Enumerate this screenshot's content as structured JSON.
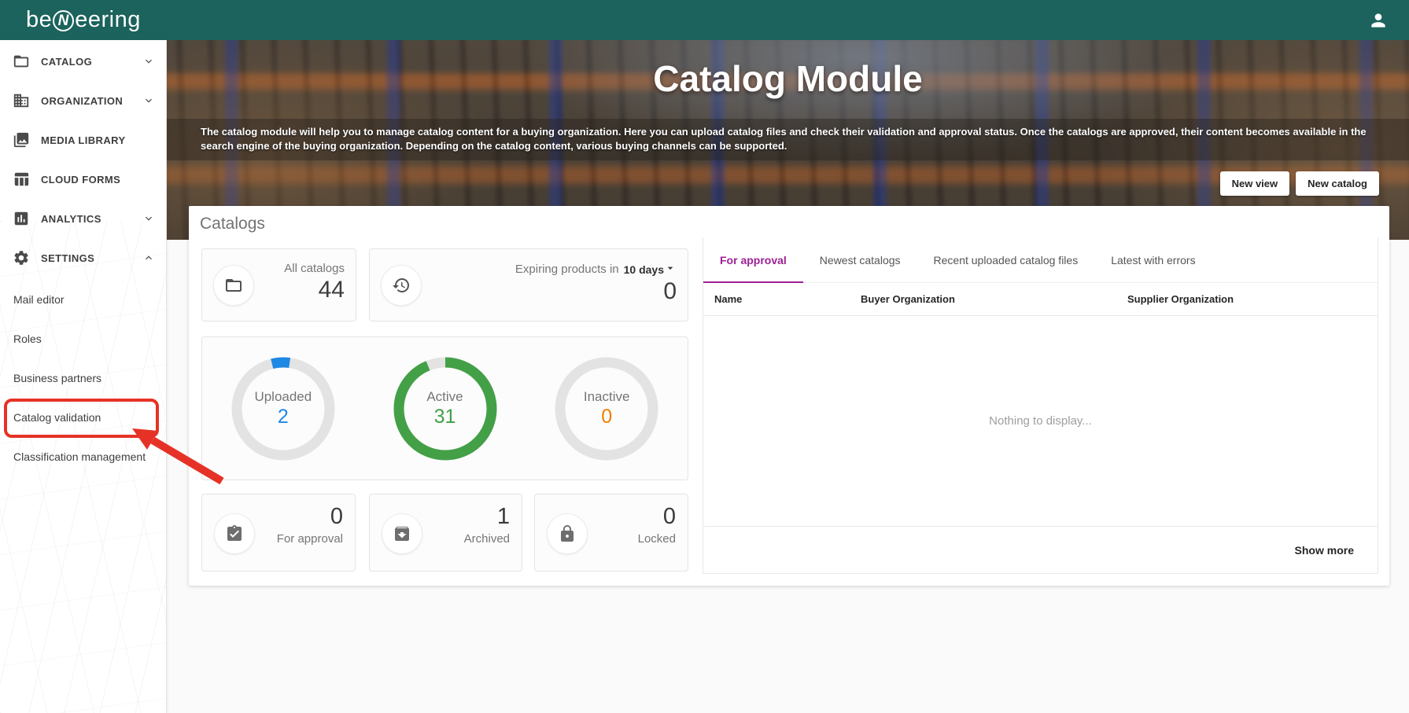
{
  "colors": {
    "header_teal": "#1b635c",
    "annotation_red": "#e63226",
    "tab_active": "#9c2196",
    "uploaded_blue": "#1e88e5",
    "active_green": "#43a047",
    "inactive_orange": "#f57c00"
  },
  "header": {
    "logo_prefix": "be",
    "logo_letter": "N",
    "logo_suffix": "eering"
  },
  "sidebar": {
    "items": [
      {
        "label": "CATALOG",
        "expandable": true
      },
      {
        "label": "ORGANIZATION",
        "expandable": true
      },
      {
        "label": "MEDIA LIBRARY",
        "expandable": false
      },
      {
        "label": "CLOUD FORMS",
        "expandable": false
      },
      {
        "label": "ANALYTICS",
        "expandable": true
      },
      {
        "label": "SETTINGS",
        "expandable": true
      }
    ],
    "settings_children": [
      {
        "label": "Mail editor"
      },
      {
        "label": "Roles"
      },
      {
        "label": "Business partners"
      },
      {
        "label": "Catalog validation"
      },
      {
        "label": "Classification management"
      }
    ]
  },
  "hero": {
    "title": "Catalog Module",
    "description": "The catalog module will help you to manage catalog content for a buying organization. Here you can upload catalog files and check their validation and approval status. Once the catalogs are approved, their content becomes available in the search engine of the buying organization. Depending on the catalog content, various buying channels can be supported.",
    "buttons": {
      "new_view": "New view",
      "new_catalog": "New catalog"
    }
  },
  "panel": {
    "title": "Catalogs",
    "all_catalogs": {
      "label": "All catalogs",
      "value": "44"
    },
    "expiring": {
      "label": "Expiring products in",
      "dropdown": "10 days",
      "value": "0"
    },
    "donuts": [
      {
        "label": "Uploaded",
        "value": "2",
        "color": "#1e88e5",
        "fraction": 0.061,
        "start_deg": -104
      },
      {
        "label": "Active",
        "value": "31",
        "color": "#43a047",
        "fraction": 0.939,
        "start_deg": -90
      },
      {
        "label": "Inactive",
        "value": "0",
        "color": "#f57c00",
        "fraction": 0,
        "start_deg": -90
      }
    ],
    "small_cards": [
      {
        "label": "For approval",
        "value": "0"
      },
      {
        "label": "Archived",
        "value": "1"
      },
      {
        "label": "Locked",
        "value": "0"
      }
    ]
  },
  "tabs": [
    {
      "label": "For approval",
      "active": true
    },
    {
      "label": "Newest catalogs",
      "active": false
    },
    {
      "label": "Recent uploaded catalog files",
      "active": false
    },
    {
      "label": "Latest with errors",
      "active": false
    }
  ],
  "table": {
    "headers": [
      "Name",
      "Buyer Organization",
      "Supplier Organization"
    ],
    "empty_text": "Nothing to display...",
    "show_more": "Show more"
  }
}
